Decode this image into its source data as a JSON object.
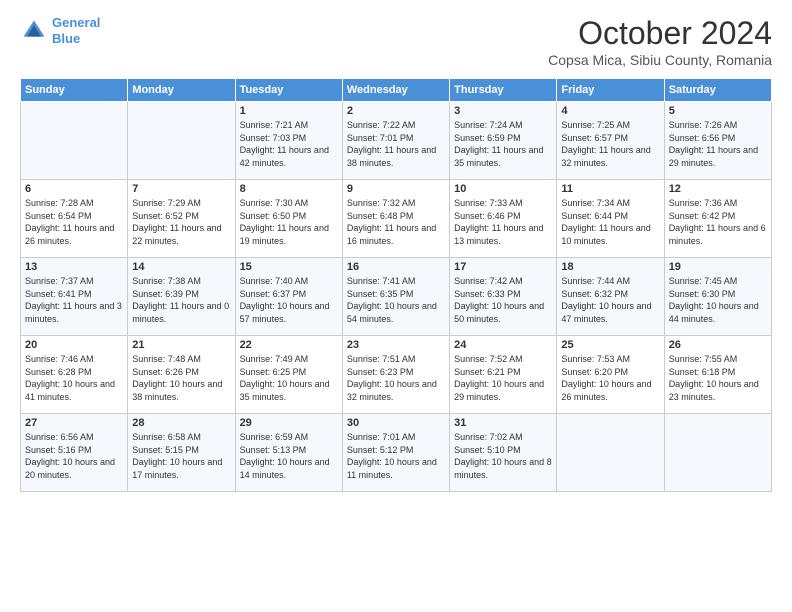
{
  "header": {
    "logo_line1": "General",
    "logo_line2": "Blue",
    "month_title": "October 2024",
    "subtitle": "Copsa Mica, Sibiu County, Romania"
  },
  "days_of_week": [
    "Sunday",
    "Monday",
    "Tuesday",
    "Wednesday",
    "Thursday",
    "Friday",
    "Saturday"
  ],
  "weeks": [
    [
      {
        "day": "",
        "info": ""
      },
      {
        "day": "",
        "info": ""
      },
      {
        "day": "1",
        "info": "Sunrise: 7:21 AM\nSunset: 7:03 PM\nDaylight: 11 hours and 42 minutes."
      },
      {
        "day": "2",
        "info": "Sunrise: 7:22 AM\nSunset: 7:01 PM\nDaylight: 11 hours and 38 minutes."
      },
      {
        "day": "3",
        "info": "Sunrise: 7:24 AM\nSunset: 6:59 PM\nDaylight: 11 hours and 35 minutes."
      },
      {
        "day": "4",
        "info": "Sunrise: 7:25 AM\nSunset: 6:57 PM\nDaylight: 11 hours and 32 minutes."
      },
      {
        "day": "5",
        "info": "Sunrise: 7:26 AM\nSunset: 6:56 PM\nDaylight: 11 hours and 29 minutes."
      }
    ],
    [
      {
        "day": "6",
        "info": "Sunrise: 7:28 AM\nSunset: 6:54 PM\nDaylight: 11 hours and 26 minutes."
      },
      {
        "day": "7",
        "info": "Sunrise: 7:29 AM\nSunset: 6:52 PM\nDaylight: 11 hours and 22 minutes."
      },
      {
        "day": "8",
        "info": "Sunrise: 7:30 AM\nSunset: 6:50 PM\nDaylight: 11 hours and 19 minutes."
      },
      {
        "day": "9",
        "info": "Sunrise: 7:32 AM\nSunset: 6:48 PM\nDaylight: 11 hours and 16 minutes."
      },
      {
        "day": "10",
        "info": "Sunrise: 7:33 AM\nSunset: 6:46 PM\nDaylight: 11 hours and 13 minutes."
      },
      {
        "day": "11",
        "info": "Sunrise: 7:34 AM\nSunset: 6:44 PM\nDaylight: 11 hours and 10 minutes."
      },
      {
        "day": "12",
        "info": "Sunrise: 7:36 AM\nSunset: 6:42 PM\nDaylight: 11 hours and 6 minutes."
      }
    ],
    [
      {
        "day": "13",
        "info": "Sunrise: 7:37 AM\nSunset: 6:41 PM\nDaylight: 11 hours and 3 minutes."
      },
      {
        "day": "14",
        "info": "Sunrise: 7:38 AM\nSunset: 6:39 PM\nDaylight: 11 hours and 0 minutes."
      },
      {
        "day": "15",
        "info": "Sunrise: 7:40 AM\nSunset: 6:37 PM\nDaylight: 10 hours and 57 minutes."
      },
      {
        "day": "16",
        "info": "Sunrise: 7:41 AM\nSunset: 6:35 PM\nDaylight: 10 hours and 54 minutes."
      },
      {
        "day": "17",
        "info": "Sunrise: 7:42 AM\nSunset: 6:33 PM\nDaylight: 10 hours and 50 minutes."
      },
      {
        "day": "18",
        "info": "Sunrise: 7:44 AM\nSunset: 6:32 PM\nDaylight: 10 hours and 47 minutes."
      },
      {
        "day": "19",
        "info": "Sunrise: 7:45 AM\nSunset: 6:30 PM\nDaylight: 10 hours and 44 minutes."
      }
    ],
    [
      {
        "day": "20",
        "info": "Sunrise: 7:46 AM\nSunset: 6:28 PM\nDaylight: 10 hours and 41 minutes."
      },
      {
        "day": "21",
        "info": "Sunrise: 7:48 AM\nSunset: 6:26 PM\nDaylight: 10 hours and 38 minutes."
      },
      {
        "day": "22",
        "info": "Sunrise: 7:49 AM\nSunset: 6:25 PM\nDaylight: 10 hours and 35 minutes."
      },
      {
        "day": "23",
        "info": "Sunrise: 7:51 AM\nSunset: 6:23 PM\nDaylight: 10 hours and 32 minutes."
      },
      {
        "day": "24",
        "info": "Sunrise: 7:52 AM\nSunset: 6:21 PM\nDaylight: 10 hours and 29 minutes."
      },
      {
        "day": "25",
        "info": "Sunrise: 7:53 AM\nSunset: 6:20 PM\nDaylight: 10 hours and 26 minutes."
      },
      {
        "day": "26",
        "info": "Sunrise: 7:55 AM\nSunset: 6:18 PM\nDaylight: 10 hours and 23 minutes."
      }
    ],
    [
      {
        "day": "27",
        "info": "Sunrise: 6:56 AM\nSunset: 5:16 PM\nDaylight: 10 hours and 20 minutes."
      },
      {
        "day": "28",
        "info": "Sunrise: 6:58 AM\nSunset: 5:15 PM\nDaylight: 10 hours and 17 minutes."
      },
      {
        "day": "29",
        "info": "Sunrise: 6:59 AM\nSunset: 5:13 PM\nDaylight: 10 hours and 14 minutes."
      },
      {
        "day": "30",
        "info": "Sunrise: 7:01 AM\nSunset: 5:12 PM\nDaylight: 10 hours and 11 minutes."
      },
      {
        "day": "31",
        "info": "Sunrise: 7:02 AM\nSunset: 5:10 PM\nDaylight: 10 hours and 8 minutes."
      },
      {
        "day": "",
        "info": ""
      },
      {
        "day": "",
        "info": ""
      }
    ]
  ]
}
